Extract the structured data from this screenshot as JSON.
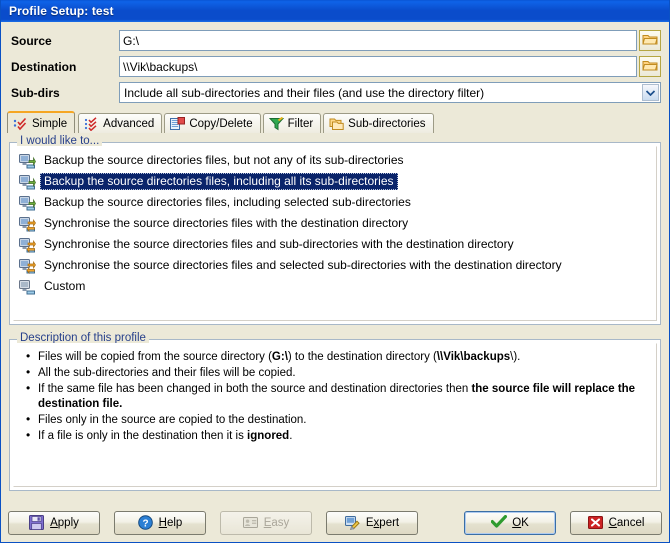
{
  "window": {
    "title": "Profile Setup: test",
    "accent_title_bg": "#0a4ccb",
    "body_bg": "#ece9d8",
    "selection_bg": "#0a246a"
  },
  "form": {
    "source": {
      "label": "Source",
      "value": "G:\\",
      "browse_tooltip": "Browse"
    },
    "destination": {
      "label": "Destination",
      "value": "\\\\Vik\\backups\\",
      "browse_tooltip": "Browse"
    },
    "subdirs": {
      "label": "Sub-dirs",
      "value": "Include all sub-directories and their files (and use the directory filter)"
    }
  },
  "tabs": [
    {
      "label": "Simple",
      "icon": "checklist-icon",
      "active": true
    },
    {
      "label": "Advanced",
      "icon": "advanced-list-icon",
      "active": false
    },
    {
      "label": "Copy/Delete",
      "icon": "copy-delete-icon",
      "active": false
    },
    {
      "label": "Filter",
      "icon": "funnel-icon",
      "active": false
    },
    {
      "label": "Sub-directories",
      "icon": "folders-icon",
      "active": false
    }
  ],
  "choice_group": {
    "legend": "I would like to...",
    "items": [
      {
        "label": "Backup the source directories files, but not any of its sub-directories",
        "icon": "backup-icon",
        "selected": false
      },
      {
        "label": "Backup the source directories files, including all its sub-directories",
        "icon": "backup-icon",
        "selected": true
      },
      {
        "label": "Backup the source directories files, including selected sub-directories",
        "icon": "backup-icon",
        "selected": false
      },
      {
        "label": "Synchronise the source directories files with the destination directory",
        "icon": "sync-icon",
        "selected": false
      },
      {
        "label": "Synchronise the source directories files and sub-directories with the destination directory",
        "icon": "sync-icon",
        "selected": false
      },
      {
        "label": "Synchronise the source directories files and selected sub-directories with the destination directory",
        "icon": "sync-icon",
        "selected": false
      },
      {
        "label": "Custom",
        "icon": "custom-icon",
        "selected": false
      }
    ]
  },
  "description_group": {
    "legend": "Description of this profile",
    "bullets": [
      {
        "parts": [
          {
            "text": "Files will be copied from the source directory (",
            "bold": false
          },
          {
            "text": "G:\\",
            "bold": true
          },
          {
            "text": ") to the destination directory (",
            "bold": false
          },
          {
            "text": "\\\\Vik\\backups",
            "bold": true
          },
          {
            "text": "\\).",
            "bold": false
          }
        ]
      },
      {
        "parts": [
          {
            "text": "All the sub-directories and their files will be copied.",
            "bold": false
          }
        ]
      },
      {
        "parts": [
          {
            "text": "If the same file has been changed in both the source and destination directories then ",
            "bold": false
          },
          {
            "text": "the source file will replace the destination file.",
            "bold": true
          }
        ]
      },
      {
        "parts": [
          {
            "text": "Files only in the source are copied to the destination.",
            "bold": false
          }
        ]
      },
      {
        "parts": [
          {
            "text": "If a file is only in the destination then it is ",
            "bold": false
          },
          {
            "text": "ignored",
            "bold": true
          },
          {
            "text": ".",
            "bold": false
          }
        ]
      }
    ]
  },
  "buttons": {
    "apply": {
      "label": "Apply",
      "accel": "A",
      "icon": "floppy-save-icon",
      "enabled": true,
      "default": false
    },
    "help": {
      "label": "Help",
      "accel": "H",
      "icon": "question-help-icon",
      "enabled": true,
      "default": false
    },
    "easy": {
      "label": "Easy",
      "accel": "E",
      "icon": "easy-card-icon",
      "enabled": false,
      "default": false
    },
    "expert": {
      "label": "Expert",
      "accel": "x",
      "icon": "expert-wizard-icon",
      "enabled": true,
      "default": false
    },
    "ok": {
      "label": "OK",
      "accel": "O",
      "icon": "green-check-icon",
      "enabled": true,
      "default": true
    },
    "cancel": {
      "label": "Cancel",
      "accel": "C",
      "icon": "red-cross-icon",
      "enabled": true,
      "default": false
    }
  }
}
